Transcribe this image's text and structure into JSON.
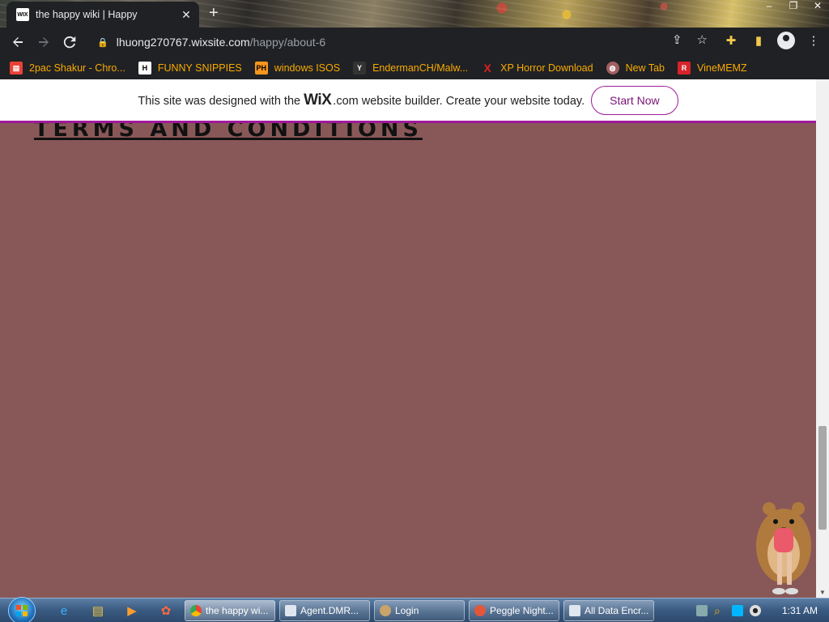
{
  "browser": {
    "tab": {
      "favicon_text": "WIX",
      "title": "the happy wiki | Happy"
    },
    "address": {
      "host": "lhuong270767.wixsite.com",
      "path": "/happy/about-6"
    },
    "bookmarks": [
      {
        "label": "2pac Shakur - Chro...",
        "icon": "chrome-store-icon",
        "color": "#e94235"
      },
      {
        "label": "FUNNY SNIPPIES",
        "icon": "h-letter-icon",
        "color": "#ffffff"
      },
      {
        "label": "windows ISOS",
        "icon": "ph-icon",
        "color": "#f7971d"
      },
      {
        "label": "EndermanCH/Malw...",
        "icon": "yp-icon",
        "color": "#333333"
      },
      {
        "label": "XP Horror Download",
        "icon": "x-icon",
        "color": "#e02020"
      },
      {
        "label": "New Tab",
        "icon": "globe-icon",
        "color": "#a06060"
      },
      {
        "label": "VineMEMZ",
        "icon": "r-icon",
        "color": "#d8232a"
      }
    ]
  },
  "page": {
    "wix_banner": {
      "prefix": "This site was designed with the",
      "logo": "WiX",
      "suffix": ".com website builder. Create your website today.",
      "cta": "Start Now"
    },
    "heading": "TERMS AND CONDITIONS",
    "background_color": "#885858"
  },
  "taskbar": {
    "tasks": [
      {
        "label": "the happy wi...",
        "icon_color": "#4285f4",
        "active": true
      },
      {
        "label": "Agent.DMR...",
        "icon_color": "#dfe6ee",
        "active": false
      },
      {
        "label": "Login",
        "icon_color": "#c9a36a",
        "active": false
      },
      {
        "label": "Peggle Night...",
        "icon_color": "#e2573b",
        "active": false
      },
      {
        "label": "All Data Encr...",
        "icon_color": "#dfe6ee",
        "active": false
      }
    ],
    "clock": "1:31 AM"
  }
}
